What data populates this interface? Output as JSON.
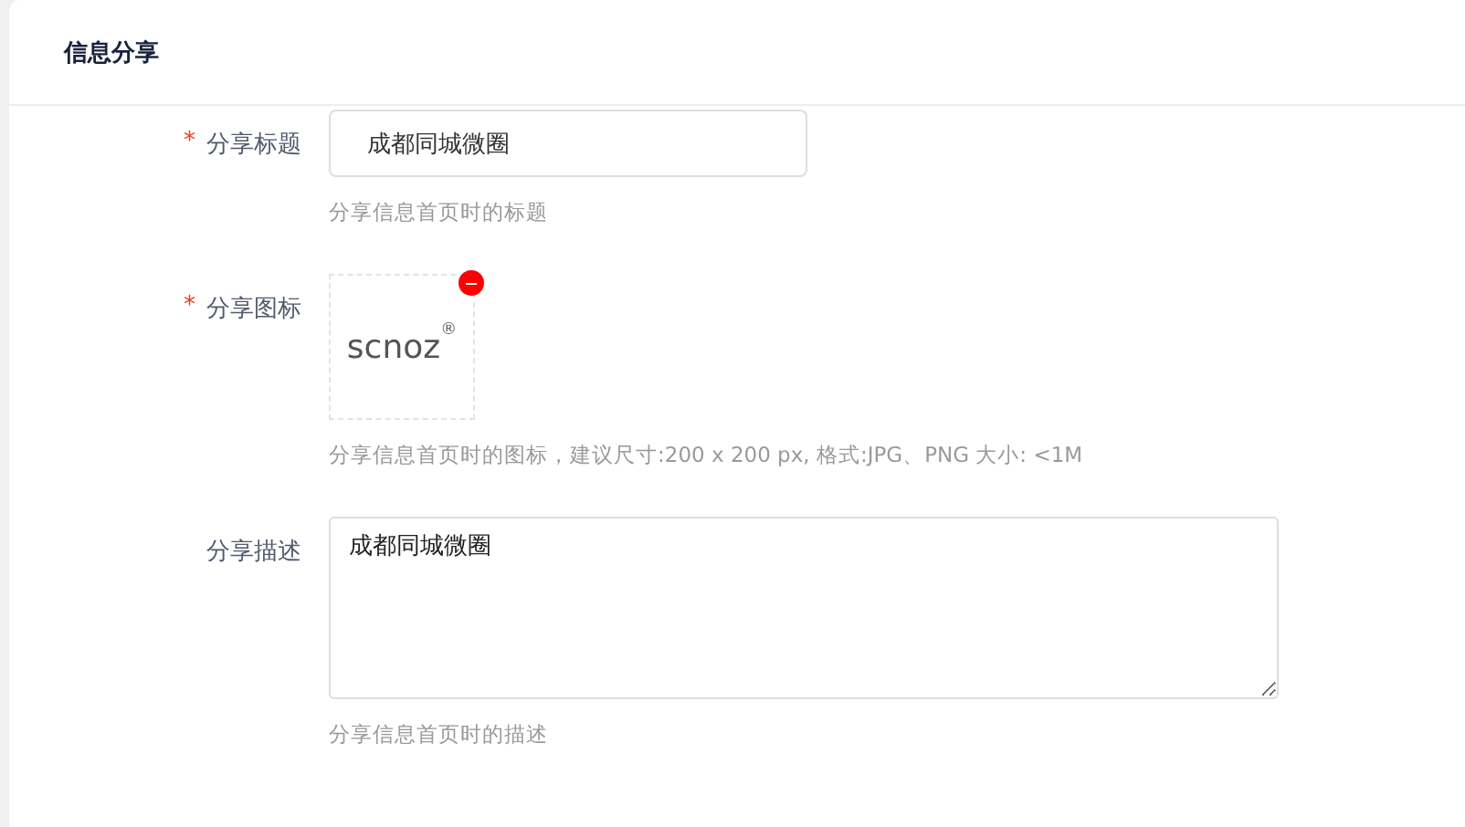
{
  "card": {
    "title": "信息分享"
  },
  "required_mark": "*",
  "fields": [
    {
      "kind": "input",
      "label": "分享标题",
      "required": true,
      "value": "成都同城微圈",
      "hint": "分享信息首页时的标题"
    },
    {
      "kind": "image",
      "label": "分享图标",
      "required": true,
      "logo_text": "scnoz",
      "logo_mark": "®",
      "removable": true,
      "hint": "分享信息首页时的图标，建议尺寸:200 x 200 px, 格式:JPG、PNG 大小: <1M"
    },
    {
      "kind": "textarea",
      "label": "分享描述",
      "required": false,
      "value": "成都同城微圈",
      "hint": "分享信息首页时的描述"
    }
  ]
}
